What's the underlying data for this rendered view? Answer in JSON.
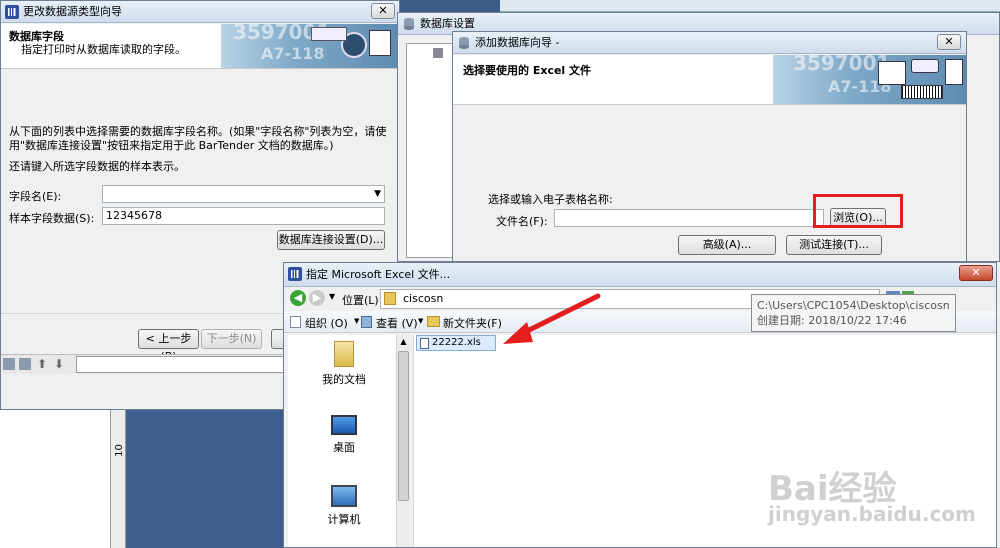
{
  "win1": {
    "title": "更改数据源类型向导",
    "close": "✕",
    "heading": "数据库字段",
    "subheading": "指定打印时从数据库读取的字段。",
    "instruction": "从下面的列表中选择需要的数据库字段名称。(如果\"字段名称\"列表为空，请使用\"数据库连接设置\"按钮来指定用于此 BarTender 文档的数据库。)",
    "sample_note": "还请键入所选字段数据的样本表示。",
    "field_name_label": "字段名(E):",
    "field_name_value": "",
    "sample_label": "样本字段数据(S):",
    "sample_value": "12345678",
    "db_settings_button": "数据库连接设置(D)...",
    "back_button": "< 上一步(B)",
    "next_button": "下一步(N) >"
  },
  "win2": {
    "title": "数据库设置"
  },
  "win3": {
    "title": "添加数据库向导 -",
    "close": "✕",
    "heading": "选择要使用的 Excel 文件",
    "prompt": "选择或输入电子表格名称:",
    "file_label": "文件名(F):",
    "file_value": "",
    "browse_button": "浏览(O)...",
    "advanced_button": "高级(A)...",
    "test_button": "测试连接(T)..."
  },
  "win4": {
    "title": "指定 Microsoft Excel 文件...",
    "close": "✕",
    "location_label": "位置(L):",
    "location_value": "ciscosn",
    "organize": "组织 (O)",
    "view": "查看 (V)",
    "new_folder": "新文件夹(F)",
    "places": [
      {
        "label": "我的文档",
        "icon": "documents-icon"
      },
      {
        "label": "桌面",
        "icon": "desktop-icon"
      },
      {
        "label": "计算机",
        "icon": "computer-icon"
      }
    ],
    "file_item": "22222.xls",
    "tooltip_path": "C:\\Users\\CPC1054\\Desktop\\ciscosn",
    "tooltip_date": "创建日期: 2018/10/22 17:46"
  },
  "banner_code": "3597001",
  "banner_code2": "A7-118",
  "ruler_value": "10",
  "watermark": {
    "brand": "Bai经验",
    "url": "jingyan.baidu.com"
  },
  "colors": {
    "accent_red": "#e41d1d",
    "canvas_blue": "#3c5a86"
  }
}
